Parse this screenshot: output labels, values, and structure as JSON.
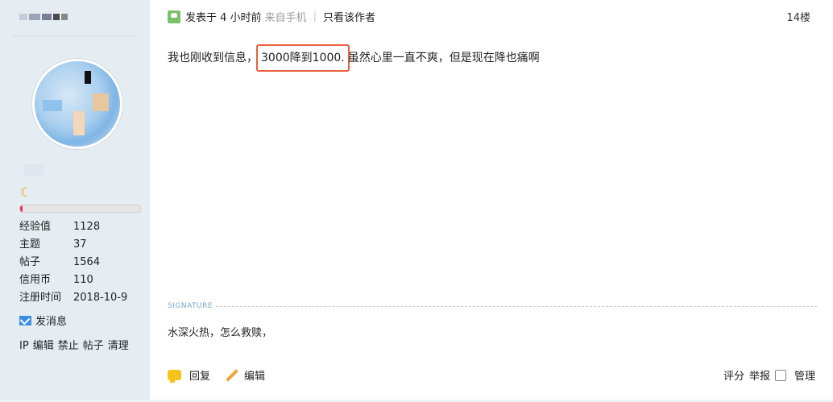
{
  "profile": {
    "stats": [
      {
        "label": "经验值",
        "value": "1128"
      },
      {
        "label": "主题",
        "value": "37"
      },
      {
        "label": "帖子",
        "value": "1564"
      },
      {
        "label": "信用币",
        "value": "110"
      },
      {
        "label": "注册时间",
        "value": "2018-10-9"
      }
    ],
    "send_message": "发消息",
    "admin_links": [
      "IP",
      "编辑",
      "禁止",
      "帖子",
      "清理"
    ],
    "level_icon": "moon-icon",
    "progress_fraction": 0.02
  },
  "post": {
    "posted_prefix": "发表于 4 小时前",
    "from_mobile": "来自手机",
    "only_author": "只看该作者",
    "floor": "14楼",
    "content_before": "我也刚收到信息，",
    "content_highlight": "3000降到1000.",
    "content_after": "虽然心里一直不爽，但是现在降也痛啊",
    "signature_label": "SIGNATURE",
    "signature_text": "水深火热，怎么救赎，"
  },
  "actions": {
    "reply": "回复",
    "edit": "编辑",
    "rate": "评分",
    "report": "举报",
    "manage": "管理"
  },
  "colors": {
    "sidebar_bg": "#e5edf2",
    "highlight_border": "#e8603c"
  }
}
